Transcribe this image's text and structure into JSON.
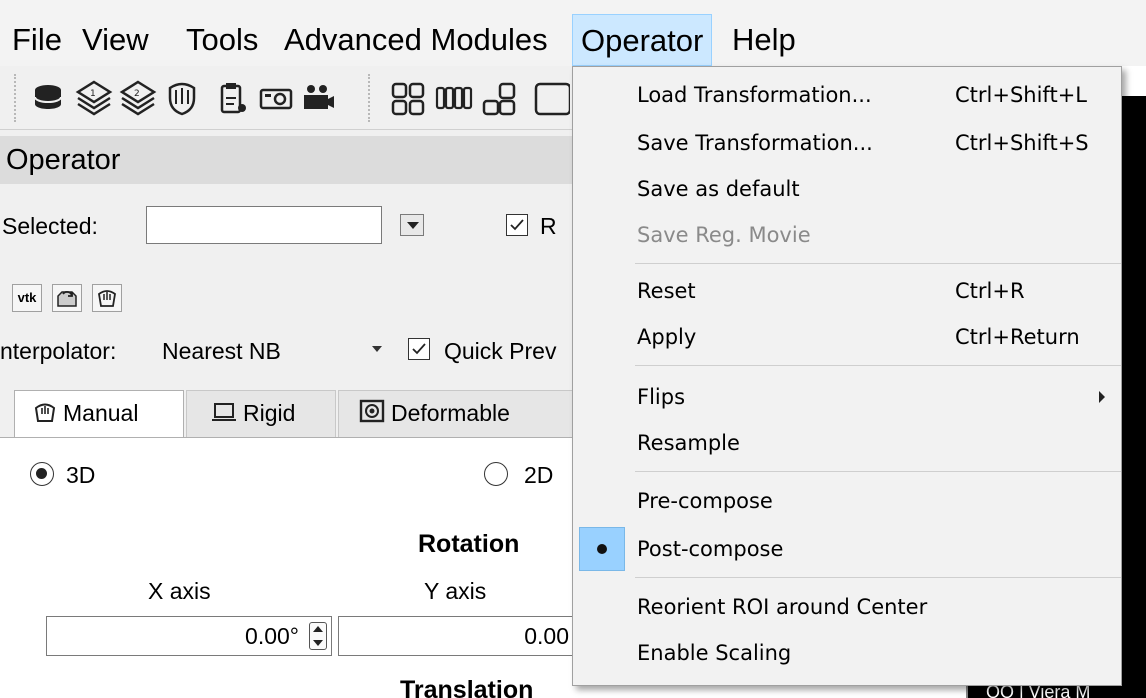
{
  "menubar": {
    "items": [
      {
        "label": "File"
      },
      {
        "label": "View"
      },
      {
        "label": "Tools"
      },
      {
        "label": "Advanced Modules"
      },
      {
        "label": "Operator",
        "active": true
      },
      {
        "label": "Help"
      }
    ]
  },
  "toolbar": {
    "icons": [
      "database-icon",
      "layer-1-icon",
      "layer-2-icon",
      "shield-hand-icon",
      "clipboard-icon",
      "camera-icon",
      "video-camera-icon",
      "grid-2x2-icon",
      "grid-4x1-icon",
      "layout-1-2-icon",
      "layout-single-icon"
    ]
  },
  "operator_panel": {
    "title": "Operator",
    "selected_label": "Selected:",
    "selected_value": "",
    "r_checkbox_label": "R",
    "r_checked": true,
    "tool_buttons": [
      "vtk"
    ],
    "interpolator_label": "nterpolator:",
    "interpolator_value": "Nearest NB",
    "quick_preview_label": "Quick Prev",
    "quick_preview_checked": true,
    "tabs": [
      {
        "label": "Manual",
        "icon": "hand-icon",
        "selected": true
      },
      {
        "label": "Rigid",
        "icon": "laptop-icon",
        "selected": false
      },
      {
        "label": "Deformable",
        "icon": "deformable-icon",
        "selected": false
      }
    ],
    "radio_3d": "3D",
    "radio_2d": "2D",
    "radio_3d_selected": true,
    "rotation_title": "Rotation",
    "x_axis_label": "X axis",
    "y_axis_label": "Y axis",
    "x_value": "0.00°",
    "y_value": "0.00",
    "translation_title": "Translation"
  },
  "dark_caption": "OO | Viera M",
  "operator_menu": {
    "items": [
      {
        "label": "Load Transformation...",
        "shortcut": "Ctrl+Shift+L"
      },
      {
        "label": "Save Transformation...",
        "shortcut": "Ctrl+Shift+S"
      },
      {
        "label": "Save as default",
        "shortcut": ""
      },
      {
        "label": "Save Reg. Movie",
        "shortcut": "",
        "disabled": true
      },
      {
        "label": "Reset",
        "shortcut": "Ctrl+R"
      },
      {
        "label": "Apply",
        "shortcut": "Ctrl+Return"
      },
      {
        "label": "Flips",
        "shortcut": "",
        "submenu": true
      },
      {
        "label": "Resample",
        "shortcut": ""
      },
      {
        "label": "Pre-compose",
        "shortcut": ""
      },
      {
        "label": "Post-compose",
        "shortcut": "",
        "checked": true
      },
      {
        "label": "Reorient ROI around Center",
        "shortcut": ""
      },
      {
        "label": "Enable Scaling",
        "shortcut": ""
      }
    ]
  },
  "colors": {
    "menu_highlight": "#cce8ff",
    "checked_item": "#99d1ff",
    "disabled_text": "#8a8a8a"
  }
}
